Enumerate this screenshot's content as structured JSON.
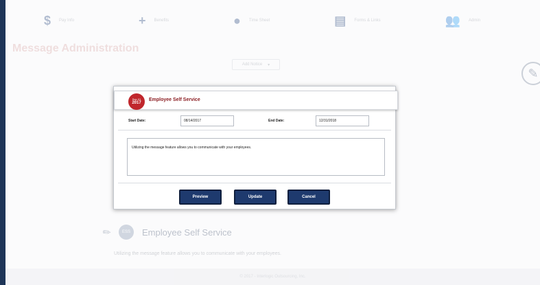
{
  "nav": {
    "items": [
      {
        "icon": "$",
        "label": "Pay Info"
      },
      {
        "icon": "+",
        "label": "Benefits"
      },
      {
        "icon": "●",
        "label": "Time Sheet"
      },
      {
        "icon": "▤",
        "label": "Forms & Links"
      },
      {
        "icon": "👥",
        "label": "Admin"
      }
    ]
  },
  "page": {
    "title": "Message Administration",
    "filter_label": "Add Notice",
    "filter_arrow": "▾",
    "side_icon": "✎"
  },
  "background_card": {
    "icon_text": "ESS",
    "title": "Employee Self Service",
    "text": "Utilizing the message feature allows you to communicate with your employees.",
    "pencil": "✎"
  },
  "modal": {
    "badge_month": "Sep 01",
    "badge_year": "2017",
    "title": "Employee Self Service",
    "start_label": "Start Date:",
    "start_value": "08/14/2017",
    "end_label": "End Date:",
    "end_value": "12/31/2018",
    "message": "Utilizing the message feature allows you to communicate with your employees.",
    "buttons": {
      "preview": "Preview",
      "update": "Update",
      "cancel": "Cancel"
    }
  },
  "footer": {
    "text": "© 2017 - Interlogic Outsourcing, Inc."
  }
}
